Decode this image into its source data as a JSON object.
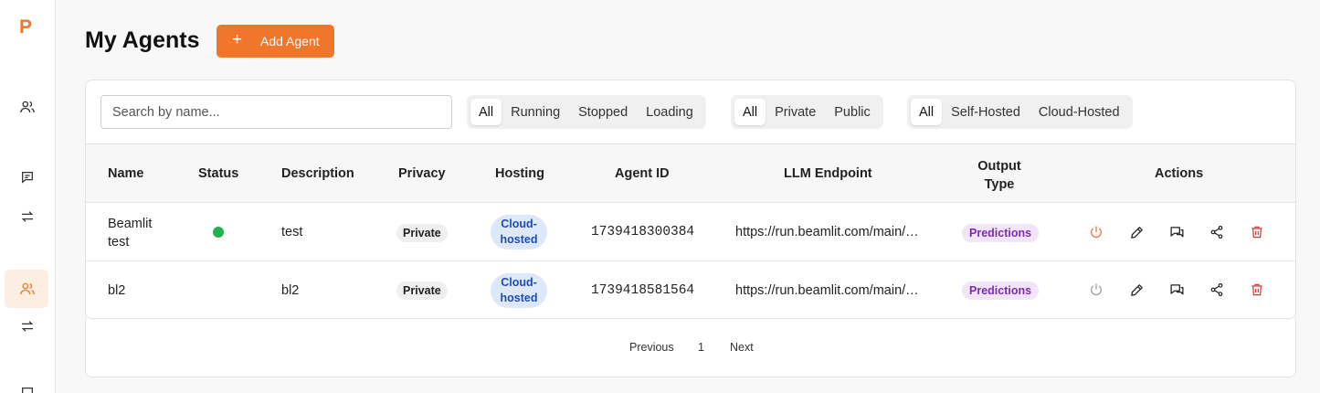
{
  "sidebar": {
    "logo": "P",
    "items": [
      {
        "icon": "users-icon"
      },
      {
        "icon": "chat-icon"
      },
      {
        "icon": "transfer-icon"
      },
      {
        "icon": "users-icon",
        "active": true
      },
      {
        "icon": "transfer-icon"
      }
    ]
  },
  "header": {
    "title": "My Agents",
    "add_button": {
      "icon": "+",
      "label": "Add Agent"
    }
  },
  "filters": {
    "search_placeholder": "Search by name...",
    "status": [
      "All",
      "Running",
      "Stopped",
      "Loading"
    ],
    "privacy": [
      "All",
      "Private",
      "Public"
    ],
    "hosting": [
      "All",
      "Self-Hosted",
      "Cloud-Hosted"
    ],
    "selected": {
      "status": "All",
      "privacy": "All",
      "hosting": "All"
    }
  },
  "table": {
    "columns": [
      "Name",
      "Status",
      "Description",
      "Privacy",
      "Hosting",
      "Agent ID",
      "LLM Endpoint",
      "Output Type",
      "Actions"
    ],
    "output_type_header": [
      "Output",
      "Type"
    ],
    "rows": [
      {
        "name_lines": [
          "Beamlit",
          "test"
        ],
        "status": "running",
        "description": "test",
        "privacy": "Private",
        "hosting_lines": [
          "Cloud-",
          "hosted"
        ],
        "agent_id": "1739418300384",
        "llm_endpoint": "https://run.beamlit.com/main/…",
        "output_type": "Predictions",
        "power_color": "#e0703a"
      },
      {
        "name_lines": [
          "bl2"
        ],
        "status": "stopped",
        "description": "bl2",
        "privacy": "Private",
        "hosting_lines": [
          "Cloud-",
          "hosted"
        ],
        "agent_id": "1739418581564",
        "llm_endpoint": "https://run.beamlit.com/main/…",
        "output_type": "Predictions",
        "power_color": "#9a9a9a"
      }
    ]
  },
  "pagination": {
    "previous": "Previous",
    "page": "1",
    "next": "Next"
  },
  "colors": {
    "accent": "#f0762c",
    "running": "#22b14c",
    "delete": "#d63b3b"
  }
}
